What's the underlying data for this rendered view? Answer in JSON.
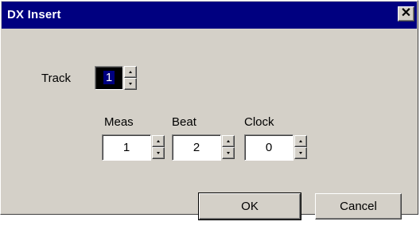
{
  "window": {
    "title": "DX Insert",
    "close_glyph": "✕"
  },
  "track": {
    "label": "Track",
    "value": "1"
  },
  "position": {
    "meas_label": "Meas",
    "beat_label": "Beat",
    "clock_label": "Clock",
    "meas_value": "1",
    "beat_value": "2",
    "clock_value": "0"
  },
  "buttons": {
    "ok_label": "OK",
    "cancel_label": "Cancel"
  },
  "colors": {
    "titlebar": "#000080",
    "face": "#d4d0c8",
    "selection": "#000080"
  }
}
